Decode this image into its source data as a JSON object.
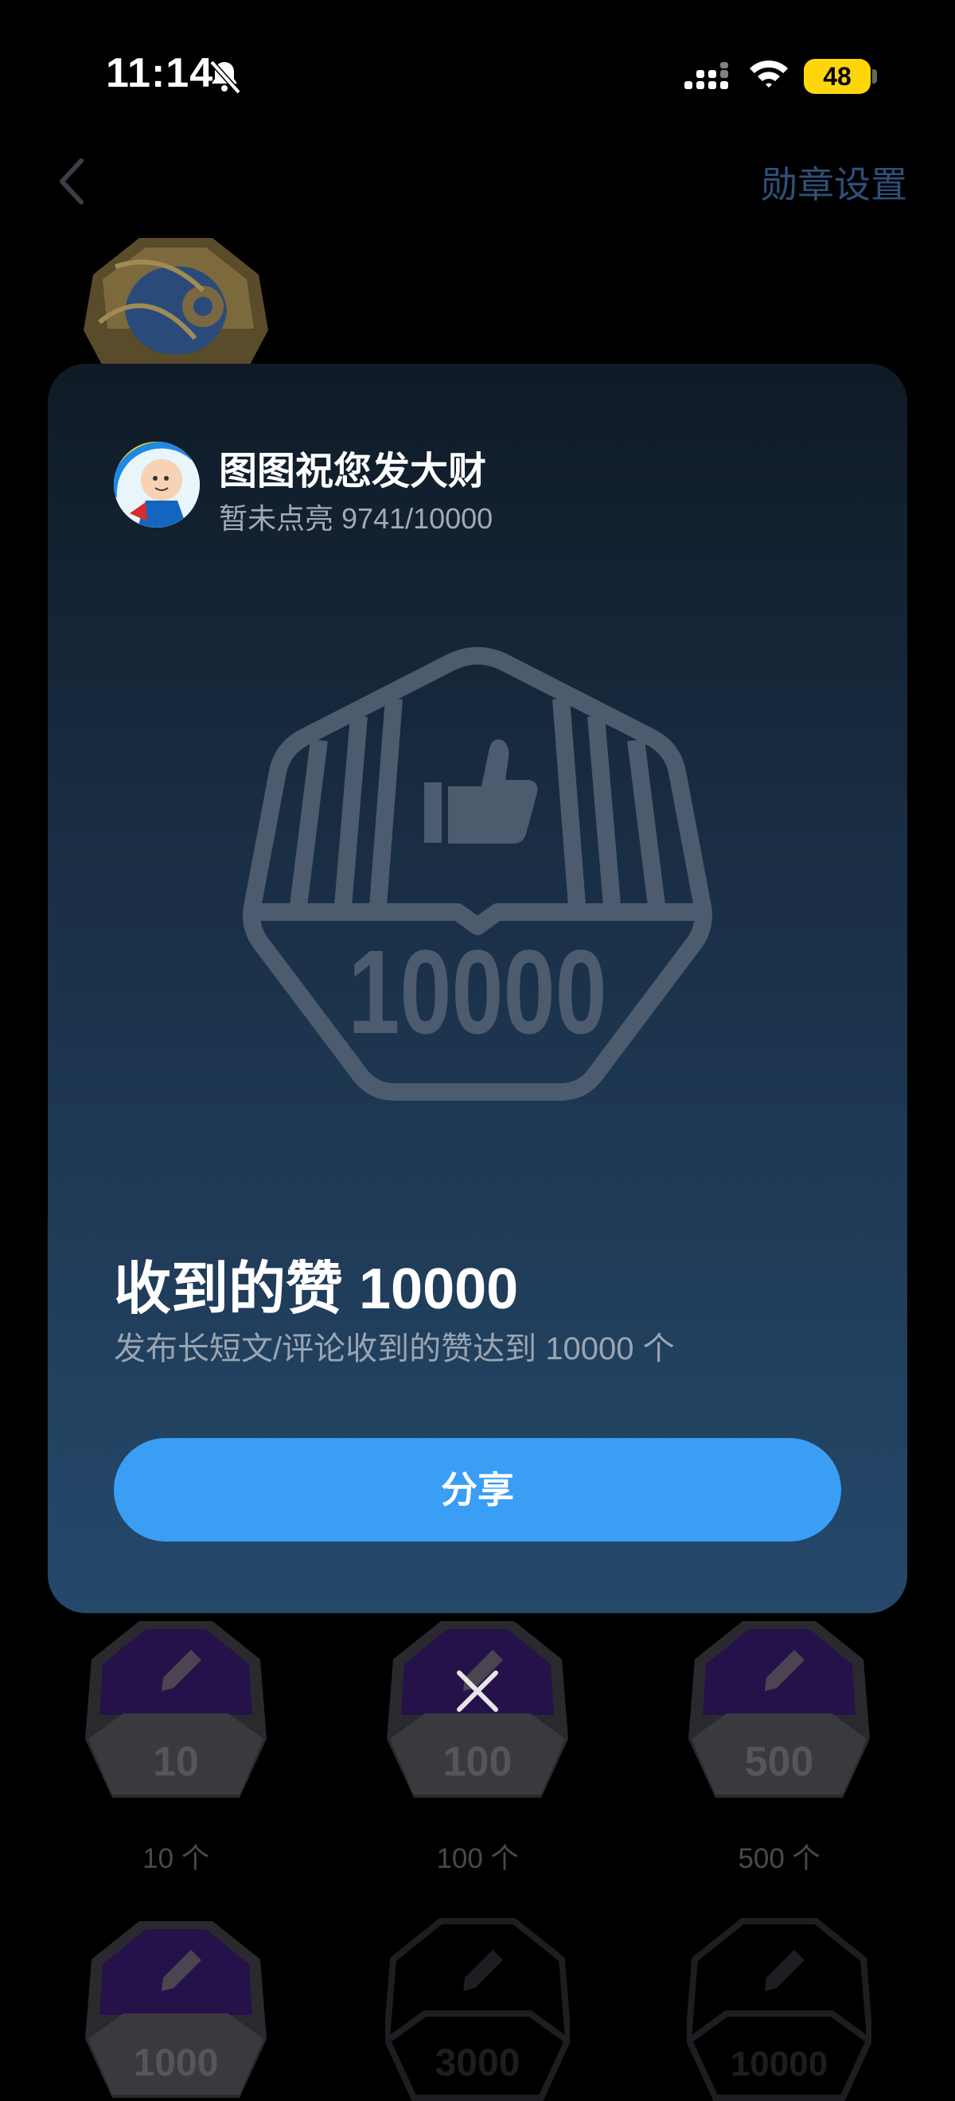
{
  "status_bar": {
    "time": "11:14",
    "battery": "48",
    "icons": [
      "bell-slash-icon",
      "cellular-signal-icon",
      "wifi-icon",
      "battery-icon"
    ]
  },
  "header": {
    "back_icon": "chevron-left-icon",
    "settings_label": "勋章设置"
  },
  "modal": {
    "user_name": "图图祝您发大财",
    "progress_text": "暂未点亮 9741/10000",
    "badge_number": "10000",
    "badge_title": "收到的赞 10000",
    "badge_desc": "发布长短文/评论收到的赞达到 10000 个",
    "share_label": "分享",
    "close_icon": "close-icon"
  },
  "background_medals": [
    {
      "number": "10",
      "caption": "10 个"
    },
    {
      "number": "100",
      "caption": "100 个"
    },
    {
      "number": "500",
      "caption": "500 个"
    },
    {
      "number": "1000",
      "caption": ""
    },
    {
      "number": "3000",
      "caption": ""
    },
    {
      "number": "10000",
      "caption": ""
    }
  ],
  "colors": {
    "accent": "#3A9EF5",
    "battery": "#FFD60A",
    "medal_purple": "#3E1F7A"
  }
}
